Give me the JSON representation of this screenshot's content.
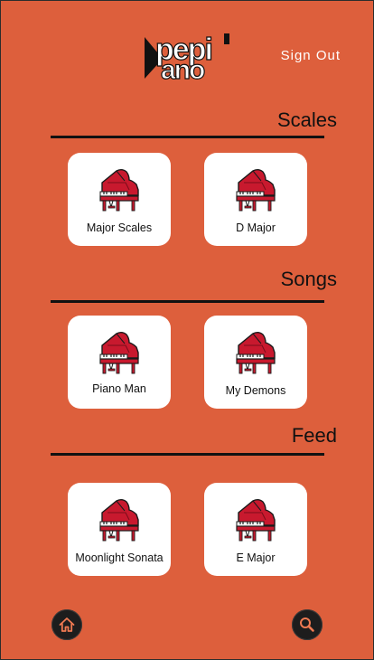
{
  "header": {
    "logo_text": "pepiano",
    "sign_out_label": "Sign Out"
  },
  "sections": [
    {
      "title": "Scales",
      "cards": [
        {
          "label": "Major Scales",
          "icon": "grand-piano-icon"
        },
        {
          "label": "D Major",
          "icon": "grand-piano-icon"
        }
      ]
    },
    {
      "title": "Songs",
      "cards": [
        {
          "label": "Piano Man",
          "icon": "grand-piano-icon"
        },
        {
          "label": "My Demons",
          "icon": "grand-piano-icon"
        }
      ]
    },
    {
      "title": "Feed",
      "cards": [
        {
          "label": "Moonlight Sonata",
          "icon": "grand-piano-icon"
        },
        {
          "label": "E Major",
          "icon": "grand-piano-icon"
        }
      ]
    }
  ],
  "bottom_nav": {
    "home_icon": "home-icon",
    "search_icon": "search-icon"
  },
  "colors": {
    "background": "#dd5f3c",
    "card": "#ffffff",
    "rule": "#111111",
    "piano": "#c8192e",
    "nav_icon": "#f07a52"
  }
}
